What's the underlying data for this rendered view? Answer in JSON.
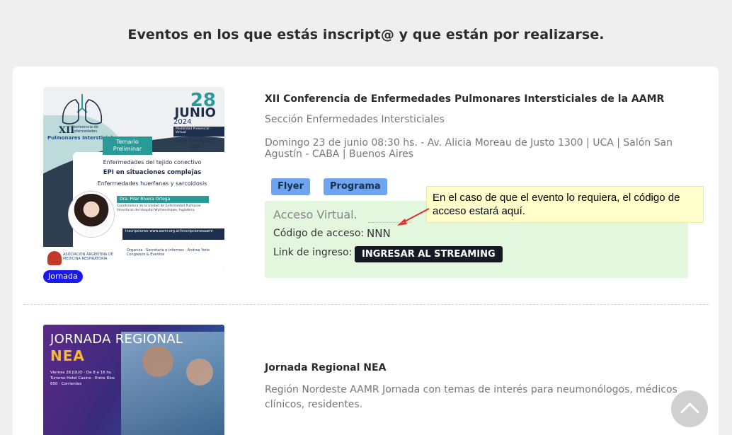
{
  "page": {
    "heading": "Eventos en los que estás inscript@ y que están por realizarse."
  },
  "events": [
    {
      "title": "XII Conferencia de Enfermedades Pulmonares Intersticiales de la AAMR",
      "section": "Sección Enfermedades Intersticiales",
      "when_where": "Domingo 23 de junio 08:30 hs. - Av. Alicia Moreau de Justo 1300 | UCA | Salón San Agustín - CABA | Buenos Aires",
      "badge": "Jornada",
      "buttons": {
        "flyer": "Flyer",
        "programa": "Programa"
      },
      "access": {
        "title": "Acceso Virtual.",
        "code_label": "Código de acceso:",
        "code_value": "NNN",
        "link_label": "Link de ingreso:",
        "stream_button": "INGRESAR AL STREAMING"
      },
      "poster": {
        "xii": "XII",
        "xii_sub": "Conferencia de Enfermedades",
        "pulmonares": "Pulmonares Intersticiales",
        "day": "28",
        "month": "JUNIO",
        "year": "2024",
        "modalidad": "Modalidad Presencial - Virtual",
        "salon": "Salón San Agustín UCA",
        "temario": "Temario Preliminar",
        "line1": "Enfermedades del tejido conectivo",
        "line2": "EPI en situaciones complejas",
        "line3": "Enfermedades huerfanas y sarcoidosis",
        "speaker": "Dra. Pilar Rivera Ortega",
        "speaker_desc": "Coordinadora de la Unidad de Enfermedad Pulmonar Intersticial del Hospital Wythenshawe, Inglaterra",
        "inscripciones": "Inscripciones www.aamr.org.ar/inscripcionesaamr",
        "org_name": "ASOCIACIÓN ARGENTINA DE MEDICINA RESPIRATORIA",
        "org_block": "Organiza · Secretaría e informes · Andrea Yorio Congresos & Eventos"
      }
    },
    {
      "title": "Jornada Regional NEA",
      "section": "Región Nordeste AAMR Jornada con temas de interés para neumonólogos, médicos clínicos, residentes.",
      "poster": {
        "line1": "JORNADA REGIONAL",
        "line2": "NEA",
        "info": "Viernes 26 JULIO · De 8 a 16 hs. · Turismo Hotel Casino · Entre Ríos 650 · Corrientes"
      }
    }
  ],
  "tooltip": {
    "text": "En el caso de que el evento lo requiera, el código de acceso estará aquí."
  },
  "icons": {
    "scroll_top": "chevron-up-icon",
    "arrow": "red-arrow-icon"
  },
  "colors": {
    "badge": "#1a1aeb",
    "chip": "#6ea5f0",
    "access_bg": "#e3f6de",
    "stream_button": "#151a22",
    "tooltip_bg": "#ffffcc",
    "arrow": "#e0302a"
  }
}
